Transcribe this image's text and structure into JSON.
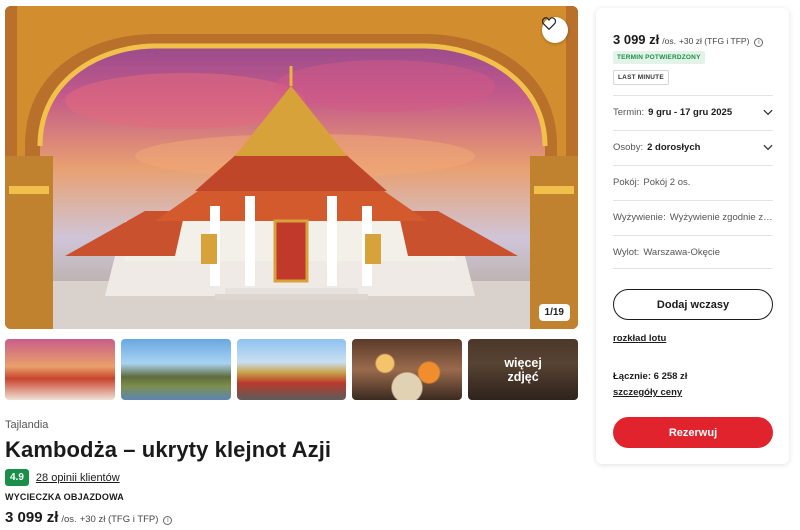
{
  "gallery": {
    "counter": "1/19",
    "more_line1": "więcej",
    "more_line2": "zdjęć"
  },
  "offer": {
    "country": "Tajlandia",
    "title": "Kambodża – ukryty klejnot Azji",
    "rating": "4.9",
    "reviews": "28 opinii klientów",
    "trip_type": "WYCIECZKA OBJAZDOWA",
    "price": "3 099 zł",
    "price_suffix": "/os.",
    "price_extra": "+30 zł (TFG i TFP)"
  },
  "booking": {
    "price": "3 099 zł",
    "price_suffix": "/os.",
    "price_extra": "+30 zł (TFG i TFP)",
    "badge_confirmed": "TERMIN POTWIERDZONY",
    "badge_last_minute": "LAST MINUTE",
    "term_label": "Termin:",
    "term_value": "9 gru - 17 gru 2025",
    "persons_label": "Osoby:",
    "persons_value": "2 dorosłych",
    "room_label": "Pokój:",
    "room_value": "Pokój 2 os.",
    "board_label": "Wyżywienie:",
    "board_value": "Wyżywienie zgodnie z programem",
    "departure_label": "Wylot:",
    "departure_value": "Warszawa-Okęcie",
    "add_button": "Dodaj wczasy",
    "flight_schedule": "rozkład lotu",
    "total": "Łącznie: 6 258 zł",
    "price_details": "szczegóły ceny",
    "reserve_button": "Rezerwuj"
  },
  "colors": {
    "accent_red": "#e1232e",
    "rating_green": "#1a8f4a"
  }
}
